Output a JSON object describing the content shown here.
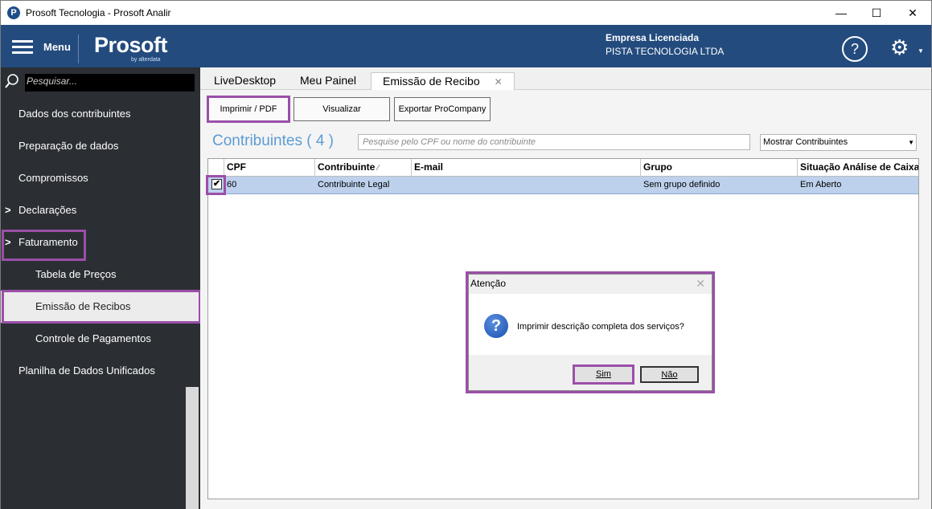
{
  "window": {
    "title": "Prosoft Tecnologia - Prosoft Analir",
    "minimize": "—",
    "maximize": "☐",
    "close": "✕"
  },
  "header": {
    "menu_label": "Menu",
    "logo_text": "Prosoft",
    "logo_sub": "by alterdata",
    "company_label": "Empresa Licenciada",
    "company_name": "PISTA TECNOLOGIA LTDA",
    "help_glyph": "?",
    "settings_glyph": "⚙"
  },
  "sidebar": {
    "search_placeholder": "Pesquisar...",
    "items": [
      {
        "label": "Dados dos contribuintes",
        "expandable": false,
        "sub": false
      },
      {
        "label": "Preparação de dados",
        "expandable": false,
        "sub": false
      },
      {
        "label": "Compromissos",
        "expandable": false,
        "sub": false
      },
      {
        "label": "Declarações",
        "expandable": true,
        "sub": false
      },
      {
        "label": "Faturamento",
        "expandable": true,
        "sub": false
      },
      {
        "label": "Tabela de Preços",
        "expandable": false,
        "sub": true
      },
      {
        "label": "Emissão de Recibos",
        "expandable": false,
        "sub": true,
        "selected": true
      },
      {
        "label": "Controle de Pagamentos",
        "expandable": false,
        "sub": true
      },
      {
        "label": "Planilha de Dados Unificados",
        "expandable": false,
        "sub": false
      }
    ]
  },
  "tabs": [
    {
      "label": "LiveDesktop",
      "active": false
    },
    {
      "label": "Meu Painel",
      "active": false
    },
    {
      "label": "Emissão de Recibo",
      "active": true,
      "close": "✕"
    }
  ],
  "toolbar": {
    "print_label": "Imprimir / PDF",
    "view_label": "Visualizar",
    "export_label": "Exportar ProCompany"
  },
  "contribuintes": {
    "title": "Contribuintes ( 4 )",
    "search_placeholder": "Pesquise pelo CPF ou nome do contribuinte",
    "filter_selected": "Mostrar Contribuintes"
  },
  "grid": {
    "columns": [
      "CPF",
      "Contribuinte",
      "E-mail",
      "Grupo",
      "Situação Análise de Caixa"
    ],
    "sort_indicator": "⁄",
    "rows": [
      {
        "checked": true,
        "cpf": "60",
        "contribuinte": "Contribuinte Legal",
        "email": "",
        "grupo": "Sem grupo definido",
        "situacao": "Em Aberto"
      }
    ]
  },
  "dialog": {
    "title": "Atenção",
    "message": "Imprimir descrição completa dos serviços?",
    "yes_label": "Sim",
    "no_label": "Não",
    "close": "✕"
  },
  "colors": {
    "header_bg": "#234b7e",
    "sidebar_bg": "#2b2f34",
    "highlight": "#9b4fa8",
    "title_accent": "#5b9bd5",
    "selected_row": "#bdd1ec"
  }
}
